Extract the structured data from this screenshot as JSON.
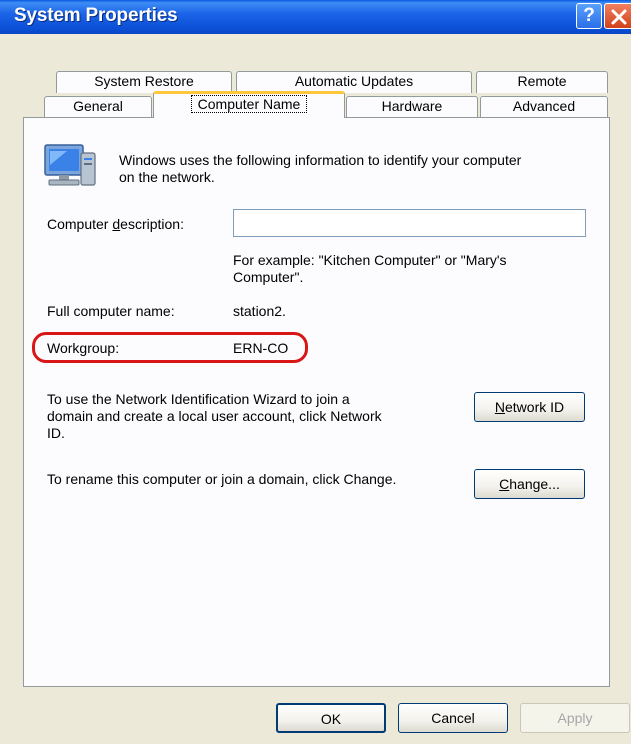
{
  "window": {
    "title": "System Properties",
    "help_glyph": "?",
    "colors": {
      "titlebar": "#0b4fd6",
      "face": "#ece9d8",
      "highlight_ring": "#d81616",
      "active_tab_accent": "#ffc83c"
    }
  },
  "tabs": {
    "row1": [
      "System Restore",
      "Automatic Updates",
      "Remote"
    ],
    "row2": [
      "General",
      "Computer Name",
      "Hardware",
      "Advanced"
    ],
    "active": "Computer Name"
  },
  "panel": {
    "intro_line1": "Windows uses the following information to identify your computer",
    "intro_line2": "on the network.",
    "description_label_pre": "Computer ",
    "description_label_accel": "d",
    "description_label_post": "escription:",
    "description_value": "",
    "example_line1": "For example: \"Kitchen Computer\" or \"Mary's",
    "example_line2": "Computer\".",
    "full_name_label": "Full computer name:",
    "full_name_value": "station2.",
    "workgroup_label": "Workgroup:",
    "workgroup_value": "ERN-CO",
    "network_text_line1": "To use the Network Identification Wizard to join a",
    "network_text_line2": "domain and create a local user account, click Network",
    "network_text_line3": "ID.",
    "network_button_accel": "N",
    "network_button_rest": "etwork ID",
    "rename_text": "To rename this computer or join a domain, click Change.",
    "change_button_accel": "C",
    "change_button_rest": "hange..."
  },
  "buttons": {
    "ok": "OK",
    "cancel": "Cancel",
    "apply": "Apply"
  }
}
